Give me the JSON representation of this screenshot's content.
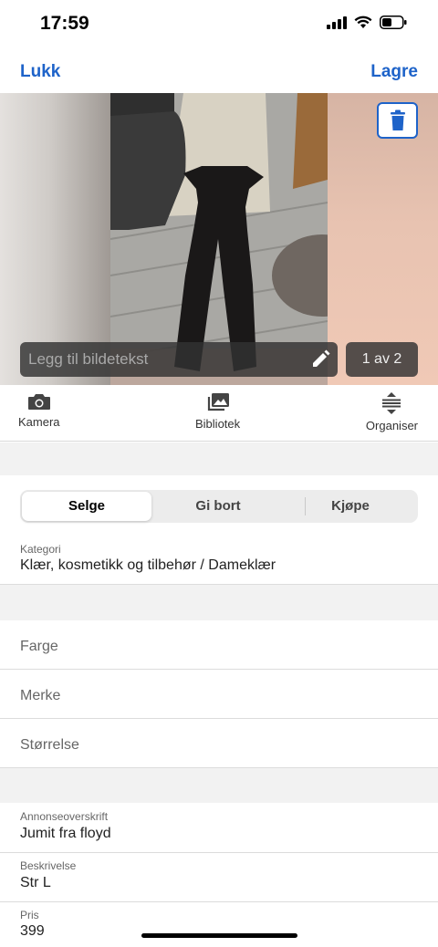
{
  "status_bar": {
    "time": "17:59"
  },
  "nav": {
    "close_label": "Lukk",
    "save_label": "Lagre"
  },
  "photo": {
    "caption_placeholder": "Legg til bildetekst",
    "page_counter": "1 av 2"
  },
  "media_toolbar": {
    "camera_label": "Kamera",
    "library_label": "Bibliotek",
    "organize_label": "Organiser"
  },
  "ad_type": {
    "options": [
      "Selge",
      "Gi bort",
      "Kjøpe"
    ],
    "selected": "Selge"
  },
  "category": {
    "label": "Kategori",
    "value": "Klær, kosmetikk og tilbehør / Dameklær"
  },
  "attributes": {
    "color_placeholder": "Farge",
    "brand_placeholder": "Merke",
    "size_placeholder": "Størrelse"
  },
  "details": {
    "title_label": "Annonseoverskrift",
    "title_value": "Jumit fra floyd",
    "description_label": "Beskrivelse",
    "description_value": "Str L",
    "price_label": "Pris",
    "price_value": "399"
  },
  "colors": {
    "accent": "#1e63c9",
    "background_band": "#f2f2f2"
  }
}
